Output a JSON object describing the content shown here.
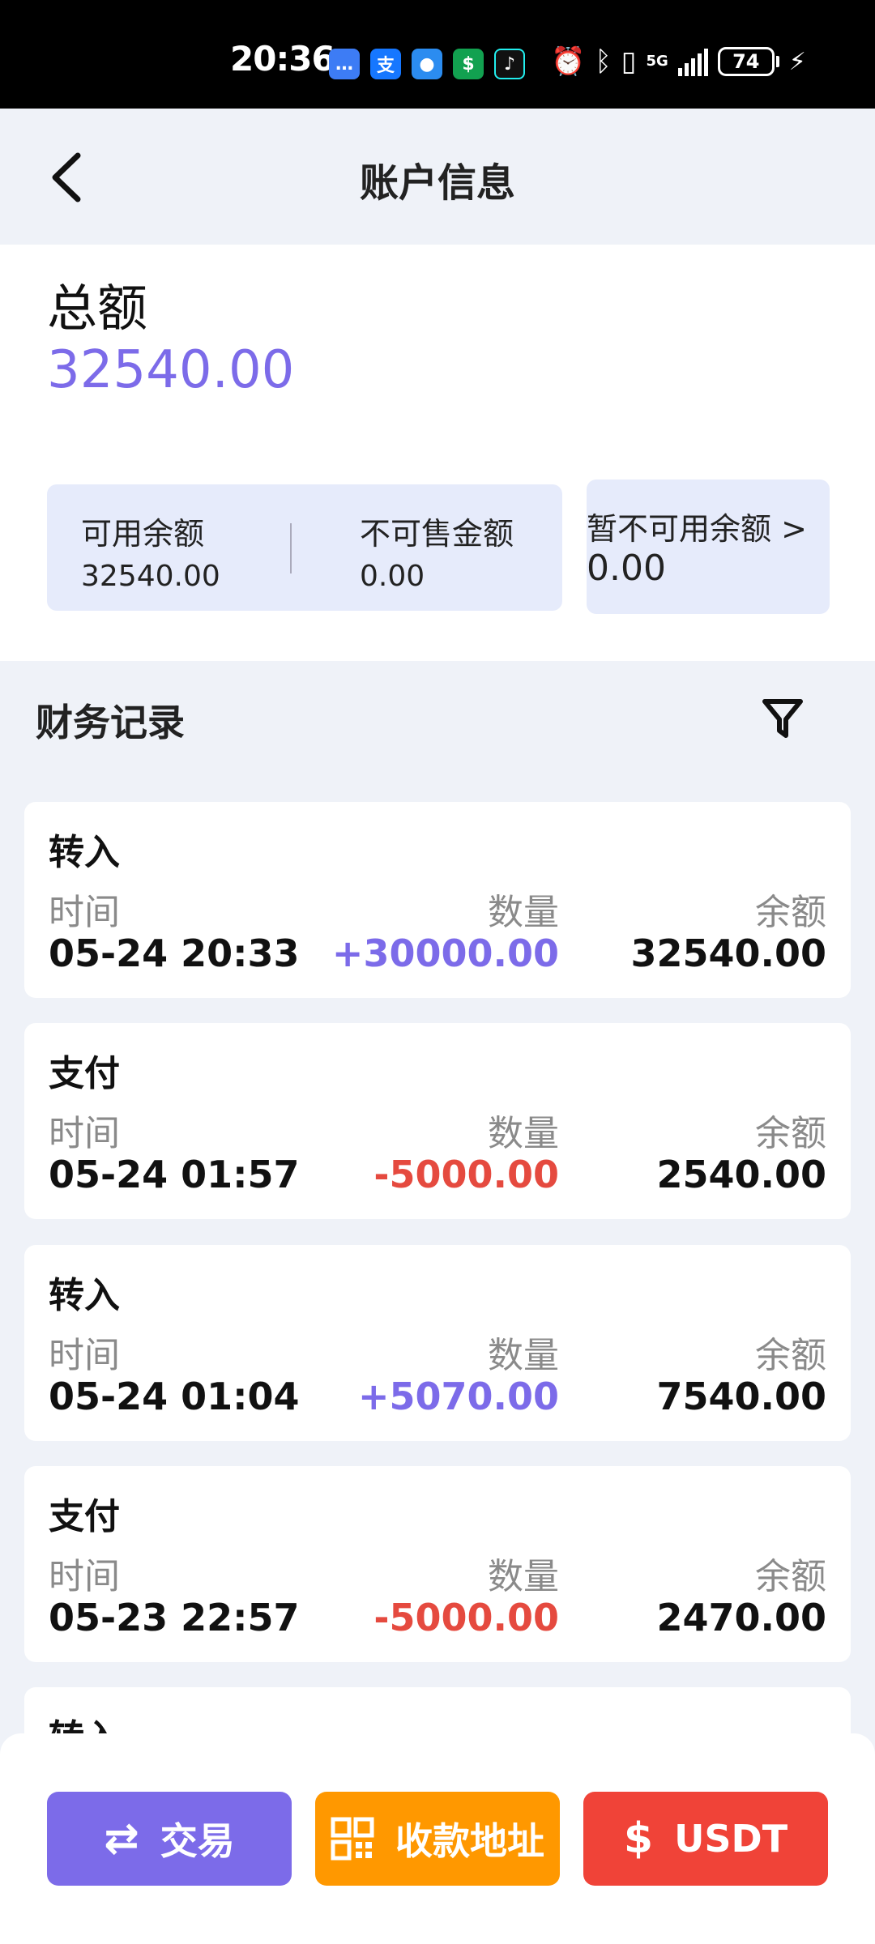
{
  "status_bar": {
    "time": "20:36",
    "network": "5G",
    "battery": "74"
  },
  "header": {
    "title": "账户信息"
  },
  "account": {
    "total_label": "总额",
    "total_value": "32540.00",
    "available_label": "可用余额",
    "available_value": "32540.00",
    "unsellable_label": "不可售金额",
    "unsellable_value": "0.00",
    "unavailable_label": "暂不可用余额 >",
    "unavailable_value": "0.00"
  },
  "records": {
    "title": "财务记录",
    "items": [
      {
        "type": "转入",
        "time_label": "时间",
        "time": "05-24 20:33",
        "qty_label": "数量",
        "qty": "+30000.00",
        "bal_label": "余额",
        "balance": "32540.00"
      },
      {
        "type": "支付",
        "time_label": "时间",
        "time": "05-24 01:57",
        "qty_label": "数量",
        "qty": "-5000.00",
        "bal_label": "余额",
        "balance": "2540.00"
      },
      {
        "type": "转入",
        "time_label": "时间",
        "time": "05-24 01:04",
        "qty_label": "数量",
        "qty": "+5070.00",
        "bal_label": "余额",
        "balance": "7540.00"
      },
      {
        "type": "支付",
        "time_label": "时间",
        "time": "05-23 22:57",
        "qty_label": "数量",
        "qty": "-5000.00",
        "bal_label": "余额",
        "balance": "2470.00"
      },
      {
        "type": "转入"
      }
    ]
  },
  "bottom": {
    "trade_label": "交易",
    "address_label": "收款地址",
    "usdt_label": "USDT"
  },
  "colors": {
    "accent": "#7c6be9",
    "negative": "#e54a3f",
    "orange": "#ff9800",
    "red": "#f04338",
    "panel": "#e6ebfb"
  }
}
